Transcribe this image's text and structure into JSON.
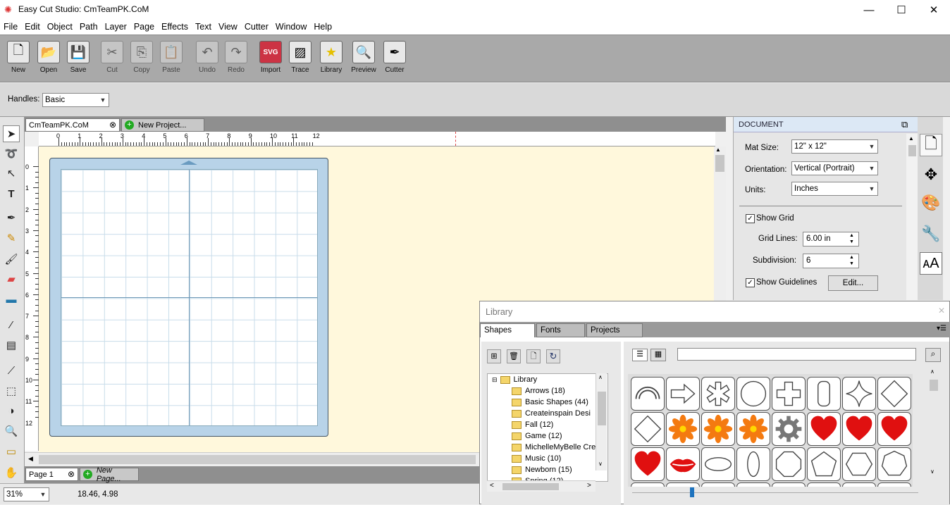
{
  "app": {
    "title": "Easy Cut Studio: CmTeamPK.CoM"
  },
  "window": {
    "minimize": "—",
    "maximize": "☐",
    "close": "✕"
  },
  "menu": [
    "File",
    "Edit",
    "Object",
    "Path",
    "Layer",
    "Page",
    "Effects",
    "Text",
    "View",
    "Cutter",
    "Window",
    "Help"
  ],
  "toolbar": [
    {
      "label": "New",
      "icon": "new-file-icon",
      "glyph": "🗋",
      "enabled": true
    },
    {
      "label": "Open",
      "icon": "open-folder-icon",
      "glyph": "📂",
      "enabled": true
    },
    {
      "label": "Save",
      "icon": "floppy-disk-icon",
      "glyph": "💾",
      "enabled": true
    },
    {
      "label": "Cut",
      "icon": "scissors-icon",
      "glyph": "✂",
      "enabled": false
    },
    {
      "label": "Copy",
      "icon": "copy-icon",
      "glyph": "⎘",
      "enabled": false
    },
    {
      "label": "Paste",
      "icon": "clipboard-icon",
      "glyph": "📋",
      "enabled": false
    },
    {
      "label": "Undo",
      "icon": "undo-icon",
      "glyph": "↶",
      "enabled": false
    },
    {
      "label": "Redo",
      "icon": "redo-icon",
      "glyph": "↷",
      "enabled": false
    },
    {
      "label": "Import",
      "icon": "svg-import-icon",
      "glyph": "SVG",
      "enabled": true
    },
    {
      "label": "Trace",
      "icon": "trace-image-icon",
      "glyph": "▨",
      "enabled": true
    },
    {
      "label": "Library",
      "icon": "star-library-icon",
      "glyph": "★",
      "enabled": true
    },
    {
      "label": "Preview",
      "icon": "magnifier-preview-icon",
      "glyph": "🔍",
      "enabled": true
    },
    {
      "label": "Cutter",
      "icon": "cutter-blade-icon",
      "glyph": "✒",
      "enabled": true
    }
  ],
  "options": {
    "handles_label": "Handles:",
    "handles_value": "Basic"
  },
  "tabs": {
    "doc_tab": "CmTeamPK.CoM",
    "new_project": "New Project..."
  },
  "ruler": {
    "h": [
      "0",
      "1",
      "2",
      "3",
      "4",
      "5",
      "6",
      "7",
      "8",
      "9",
      "10",
      "11",
      "12"
    ],
    "v": [
      "0",
      "1",
      "2",
      "3",
      "4",
      "5",
      "6",
      "7",
      "8",
      "9",
      "10",
      "11",
      "12"
    ]
  },
  "pages": {
    "page_label": "Page 1",
    "new_page": "New Page..."
  },
  "status": {
    "zoom": "31%",
    "coords": "18.46, 4.98"
  },
  "document": {
    "header": "DOCUMENT",
    "mat_size_label": "Mat Size:",
    "mat_size_value": "12\" x 12\"",
    "orientation_label": "Orientation:",
    "orientation_value": "Vertical (Portrait)",
    "units_label": "Units:",
    "units_value": "Inches",
    "show_grid_label": "Show Grid",
    "show_grid_checked": true,
    "grid_lines_label": "Grid Lines:",
    "grid_lines_value": "6.00 in",
    "subdivision_label": "Subdivision:",
    "subdivision_value": "6",
    "show_guidelines_label": "Show Guidelines",
    "show_guidelines_checked": true,
    "edit_button": "Edit..."
  },
  "library": {
    "title": "Library",
    "tabs": [
      "Shapes",
      "Fonts",
      "Projects"
    ],
    "search_value": "",
    "tree": [
      {
        "label": "Library",
        "level": 0
      },
      {
        "label": "Arrows (18)",
        "level": 1
      },
      {
        "label": "Basic Shapes (44)",
        "level": 1
      },
      {
        "label": "Createinspain Desi",
        "level": 1
      },
      {
        "label": "Fall (12)",
        "level": 1
      },
      {
        "label": "Game (12)",
        "level": 1
      },
      {
        "label": "MichelleMyBelle Cre",
        "level": 1
      },
      {
        "label": "Music (10)",
        "level": 1
      },
      {
        "label": "Newborn (15)",
        "level": 1
      },
      {
        "label": "Spring (12)",
        "level": 1
      }
    ],
    "shapes": [
      "arc",
      "arrow",
      "asterisk",
      "circle",
      "cross",
      "rounded-rect",
      "star4",
      "diamond",
      "diamond",
      "flower",
      "flower",
      "flower",
      "gear",
      "heart",
      "heart",
      "heart",
      "heart",
      "lips",
      "ellipse-h",
      "ellipse-v",
      "octagon",
      "pentagon",
      "hexagon",
      "heptagon"
    ]
  }
}
